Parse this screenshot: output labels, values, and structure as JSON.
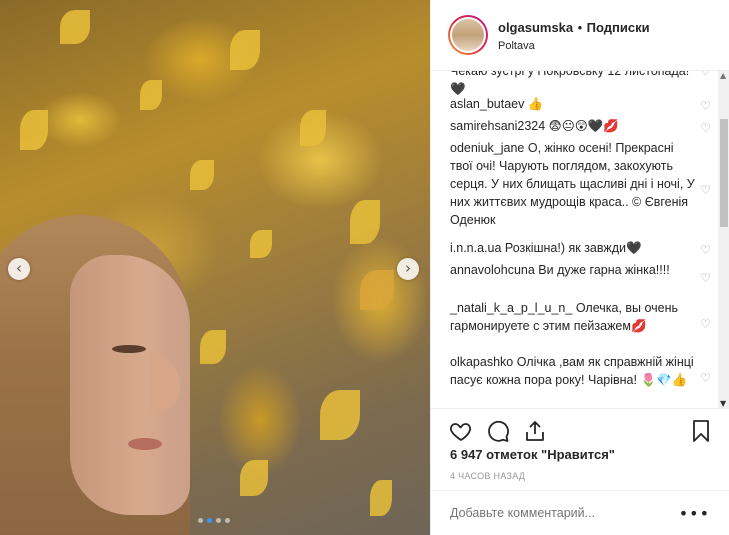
{
  "post": {
    "photo_alt": "Autumn portrait with yellow leaves",
    "carousel_dots": 4,
    "active_dot": 2
  },
  "header": {
    "username": "olgasumska",
    "separator": "•",
    "follow_label": "Подписки",
    "location": "Poltava"
  },
  "comments": [
    {
      "user": "",
      "text": "Чекаю зустрі у Покровську 12 листопада!🖤"
    },
    {
      "user": "aslan_butaev",
      "text": " 👍"
    },
    {
      "user": "samirehsani2324",
      "text": " 😨😐😲🖤💋"
    },
    {
      "user": "odeniuk_jane",
      "text": " О, жінко осені! Прекрасні твої очі! Чарують поглядом, закохують серця. У них блищать щасливі дні і ночі, У них життєвих мудрощів краса.. © Євгенія Оденюк"
    },
    {
      "user": "i.n.n.a.ua",
      "text": " Розкішна!) як завжди🖤"
    },
    {
      "user": "annavolohcuna",
      "text": " Ви дуже гарна жінка!!!!"
    },
    {
      "user": "_natali_k_a_p_l_u_n_",
      "text": " Олечка, вы очень гармонируете с этим пейзажем💋"
    },
    {
      "user": "olkapashko",
      "text": " Олічка ,вам як справжній жінці пасує кожна пора року! Чарівна! 🌷💎👍"
    }
  ],
  "likes_text": "6 947 отметок \"Нравится\"",
  "time_text": "4 ЧАСОВ НАЗАД",
  "add_comment": {
    "placeholder": "Добавьте комментарий..."
  },
  "icons": {
    "heart": "♡",
    "prev": "‹",
    "next": "›",
    "more": "•••"
  },
  "colors": {
    "accent": "#3897f0",
    "text": "#262626",
    "muted": "#999999"
  }
}
